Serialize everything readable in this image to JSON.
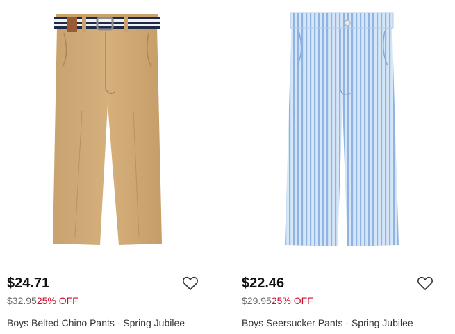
{
  "products": [
    {
      "image_alt": "Boys Belted Chino Pants - Spring Jubilee",
      "price": "$24.71",
      "original_price": "$32.95",
      "discount": "25% OFF",
      "title": "Boys Belted Chino Pants - Spring Jubilee",
      "favorite_icon": "heart-outline-icon",
      "colors": {
        "fabric": "#d2ad79",
        "belt_navy": "#1e2a4a",
        "belt_white": "#f2f2f2",
        "tab": "#9a5a34"
      }
    },
    {
      "image_alt": "Boys Seersucker Pants - Spring Jubilee",
      "price": "$22.46",
      "original_price": "$29.95",
      "discount": "25% OFF",
      "title": "Boys Seersucker Pants - Spring Jubilee",
      "favorite_icon": "heart-outline-icon",
      "colors": {
        "fabric": "#c9dcf1",
        "stripe": "#8fb3e2"
      }
    }
  ],
  "theme": {
    "sale_color": "#c8102e",
    "price_color": "#111111",
    "muted": "#666666"
  }
}
